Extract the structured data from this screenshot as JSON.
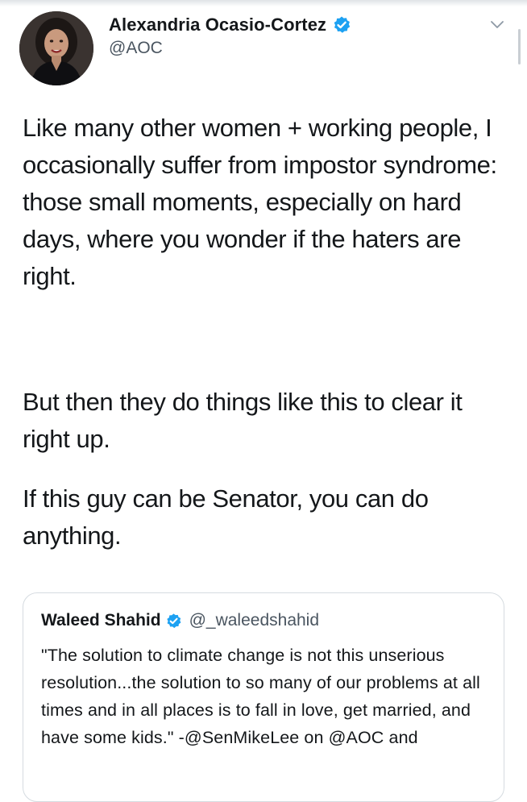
{
  "author": {
    "display_name": "Alexandria Ocasio-Cortez",
    "handle": "@AOC",
    "verified": true
  },
  "tweet": {
    "paragraphs": [
      "Like many other women + working people, I occasionally suffer from impostor syndrome: those small moments, especially on hard days, where you wonder if the haters are right.",
      "But then they do things like this to clear it right up.",
      "If this guy can be Senator, you can do anything."
    ]
  },
  "quoted_tweet": {
    "display_name": "Waleed Shahid",
    "handle": "@_waleedshahid",
    "verified": true,
    "text": "\"The solution to climate change is not this unserious resolution...the solution to so many of our problems at all times and in all places is to fall in love, get married, and have some kids.\" -@SenMikeLee on @AOC and"
  },
  "icons": {
    "verified": "verified-badge-icon",
    "menu": "chevron-down-icon"
  },
  "colors": {
    "verified_blue": "#1da1f2",
    "text": "#14171a",
    "secondary_text": "#4a5560",
    "border": "#d5dbe0"
  }
}
